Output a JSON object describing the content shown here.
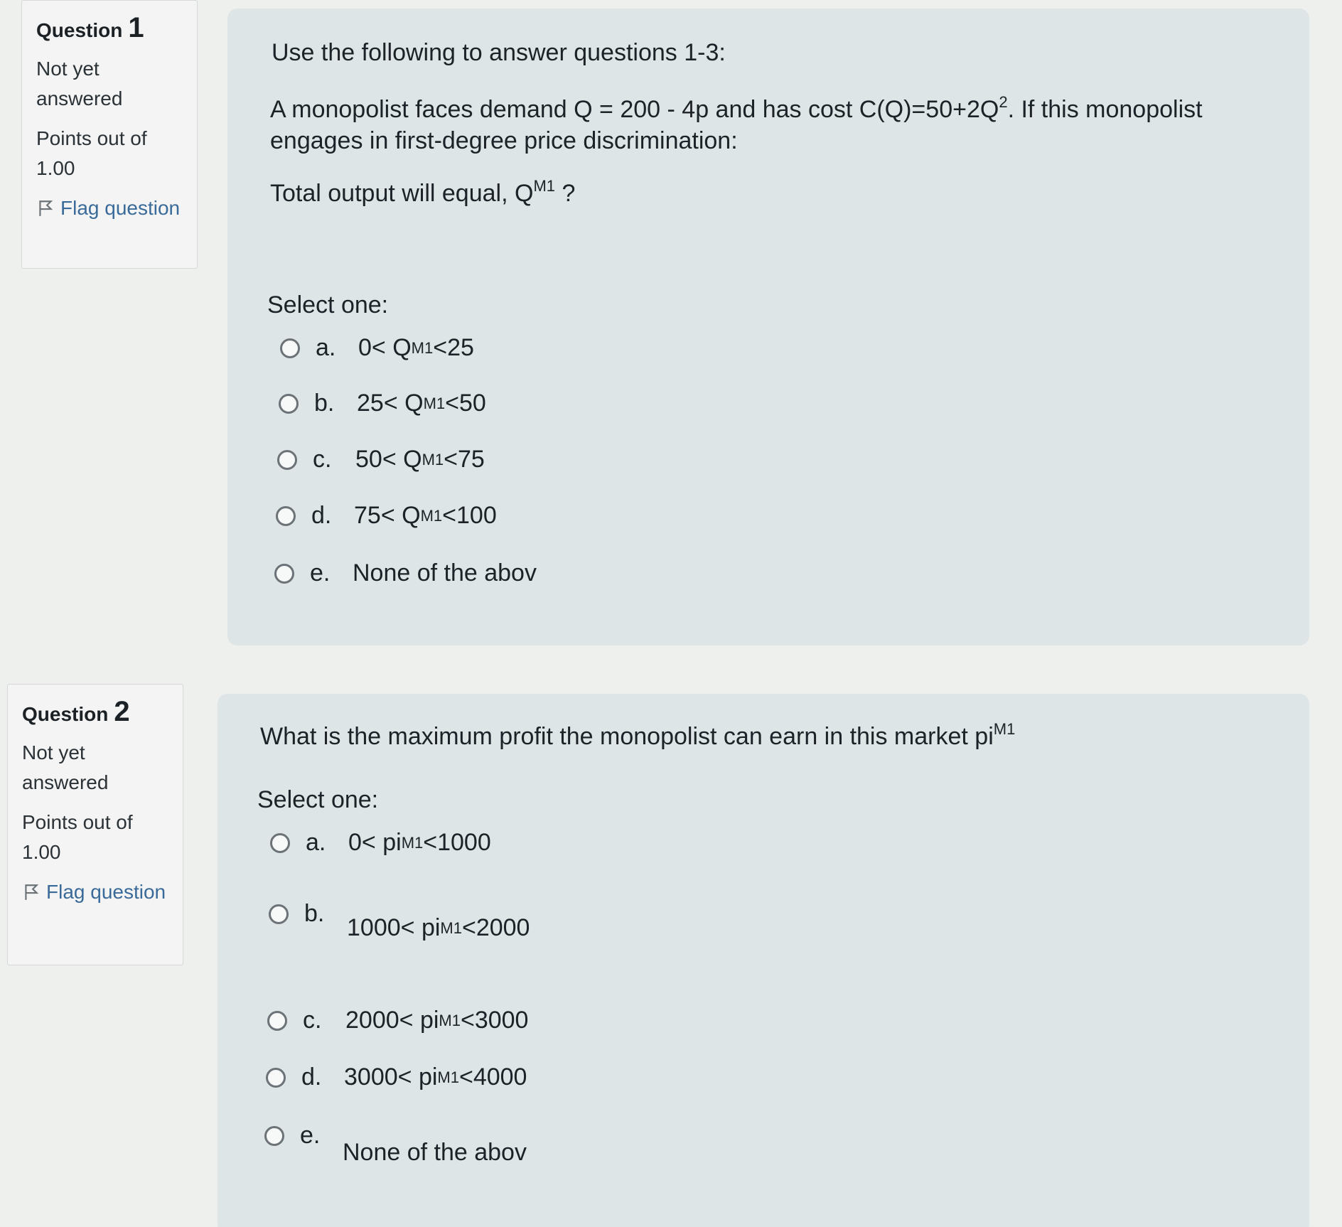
{
  "questions": [
    {
      "label": "Question",
      "number": "1",
      "status": "Not yet answered",
      "points": "Points out of 1.00",
      "flag": "Flag question",
      "intro": "Use the following to answer questions 1-3:",
      "text_part1": "A monopolist faces demand Q = 200 - 4p and has cost  C(Q)=50+2Q",
      "text_sup": "2",
      "text_part2": ". If this monopolist",
      "text_line2": "engages in first-degree price discrimination:",
      "prompt": "Total output will equal, Q",
      "prompt_sup": "M1",
      "prompt_end": " ?",
      "select_label": "Select one:",
      "options": [
        {
          "letter": "a.",
          "pre": "0< Q",
          "sup": "M1",
          "post": " <25"
        },
        {
          "letter": "b.",
          "pre": "25< Q",
          "sup": "M1",
          "post": " <50"
        },
        {
          "letter": "c.",
          "pre": "50< Q",
          "sup": "M1",
          "post": " <75"
        },
        {
          "letter": "d.",
          "pre": "75< Q",
          "sup": "M1",
          "post": " <100"
        },
        {
          "letter": "e.",
          "pre": "None of the abov",
          "sup": "",
          "post": ""
        }
      ]
    },
    {
      "label": "Question",
      "number": "2",
      "status": "Not yet answered",
      "points": "Points out of 1.00",
      "flag": "Flag question",
      "prompt": "What is the maximum profit the monopolist can earn in this market pi",
      "prompt_sup": "M1",
      "select_label": "Select one:",
      "options": [
        {
          "letter": "a.",
          "pre": "0< pi",
          "sup": "M1",
          "post": " <1000"
        },
        {
          "letter": "b.",
          "pre": "1000< pi",
          "sup": "M1",
          "post": " <2000"
        },
        {
          "letter": "c.",
          "pre": "2000< pi",
          "sup": "M1",
          "post": " <3000"
        },
        {
          "letter": "d.",
          "pre": "3000< pi",
          "sup": "M1",
          "post": " <4000"
        },
        {
          "letter": "e.",
          "pre": "None of the abov",
          "sup": "",
          "post": ""
        }
      ]
    }
  ]
}
